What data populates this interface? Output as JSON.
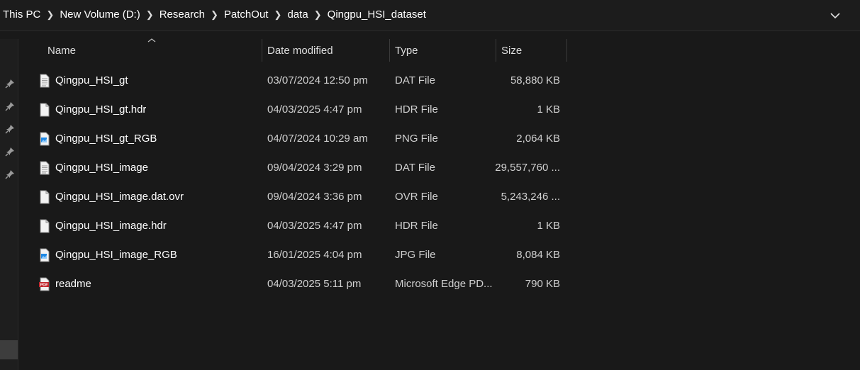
{
  "breadcrumb": {
    "items": [
      "This PC",
      "New Volume (D:)",
      "Research",
      "PatchOut",
      "data",
      "Qingpu_HSI_dataset"
    ]
  },
  "columns": {
    "name": "Name",
    "date": "Date modified",
    "type": "Type",
    "size": "Size"
  },
  "files": [
    {
      "name": "Qingpu_HSI_gt",
      "date": "03/07/2024 12:50 pm",
      "type": "DAT File",
      "size": "58,880 KB",
      "icon": "text-document-icon"
    },
    {
      "name": "Qingpu_HSI_gt.hdr",
      "date": "04/03/2025 4:47 pm",
      "type": "HDR File",
      "size": "1 KB",
      "icon": "blank-file-icon"
    },
    {
      "name": "Qingpu_HSI_gt_RGB",
      "date": "04/07/2024 10:29 am",
      "type": "PNG File",
      "size": "2,064 KB",
      "icon": "image-file-icon"
    },
    {
      "name": "Qingpu_HSI_image",
      "date": "09/04/2024 3:29 pm",
      "type": "DAT File",
      "size": "29,557,760 ...",
      "icon": "text-document-icon"
    },
    {
      "name": "Qingpu_HSI_image.dat.ovr",
      "date": "09/04/2024 3:36 pm",
      "type": "OVR File",
      "size": "5,243,246 ...",
      "icon": "blank-file-icon"
    },
    {
      "name": "Qingpu_HSI_image.hdr",
      "date": "04/03/2025 4:47 pm",
      "type": "HDR File",
      "size": "1 KB",
      "icon": "blank-file-icon"
    },
    {
      "name": "Qingpu_HSI_image_RGB",
      "date": "16/01/2025 4:04 pm",
      "type": "JPG File",
      "size": "8,084 KB",
      "icon": "image-file-icon"
    },
    {
      "name": "readme",
      "date": "04/03/2025 5:11 pm",
      "type": "Microsoft Edge PD...",
      "size": "790 KB",
      "icon": "pdf-file-icon"
    }
  ],
  "colors": {
    "background": "#191919",
    "text": "#ffffff",
    "pdf_red": "#c1272d",
    "image_blue": "#1e88e5"
  }
}
